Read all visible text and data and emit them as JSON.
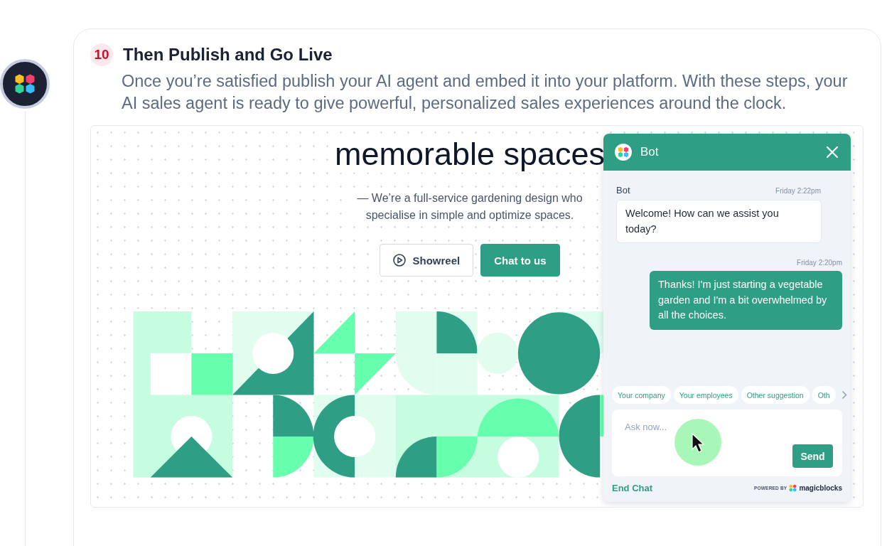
{
  "step": {
    "number": "10",
    "title": "Then Publish and Go Live",
    "description": "Once you’re satisfied publish your AI agent and embed it into your platform. With these steps, your AI sales agent is ready to give powerful, personalized sales experiences around the clock."
  },
  "preview": {
    "headline": "memorable spaces",
    "tagline": "— We’re a full-service gardening design who specialise in simple and optimize spaces.",
    "buttons": [
      {
        "label": "Showreel",
        "kind": "outline"
      },
      {
        "label": "Chat to us",
        "kind": "primary"
      }
    ]
  },
  "chat": {
    "title": "Bot",
    "messages": [
      {
        "kind": "bot",
        "sender": "Bot",
        "time": "Friday 2:22pm",
        "text": "Welcome! How can we assist you today?"
      },
      {
        "kind": "user",
        "time": "Friday 2:20pm",
        "text": "Thanks! I'm just starting a vegetable garden and I'm a bit overwhelmed by all the choices."
      }
    ],
    "suggestions": [
      "Your company",
      "Your employees",
      "Other suggestion",
      "Oth"
    ],
    "input": {
      "placeholder": "Ask now..."
    },
    "send": "Send",
    "end_chat": "End Chat",
    "powered_by": "POWERED BY",
    "brand": "magicblocks"
  }
}
